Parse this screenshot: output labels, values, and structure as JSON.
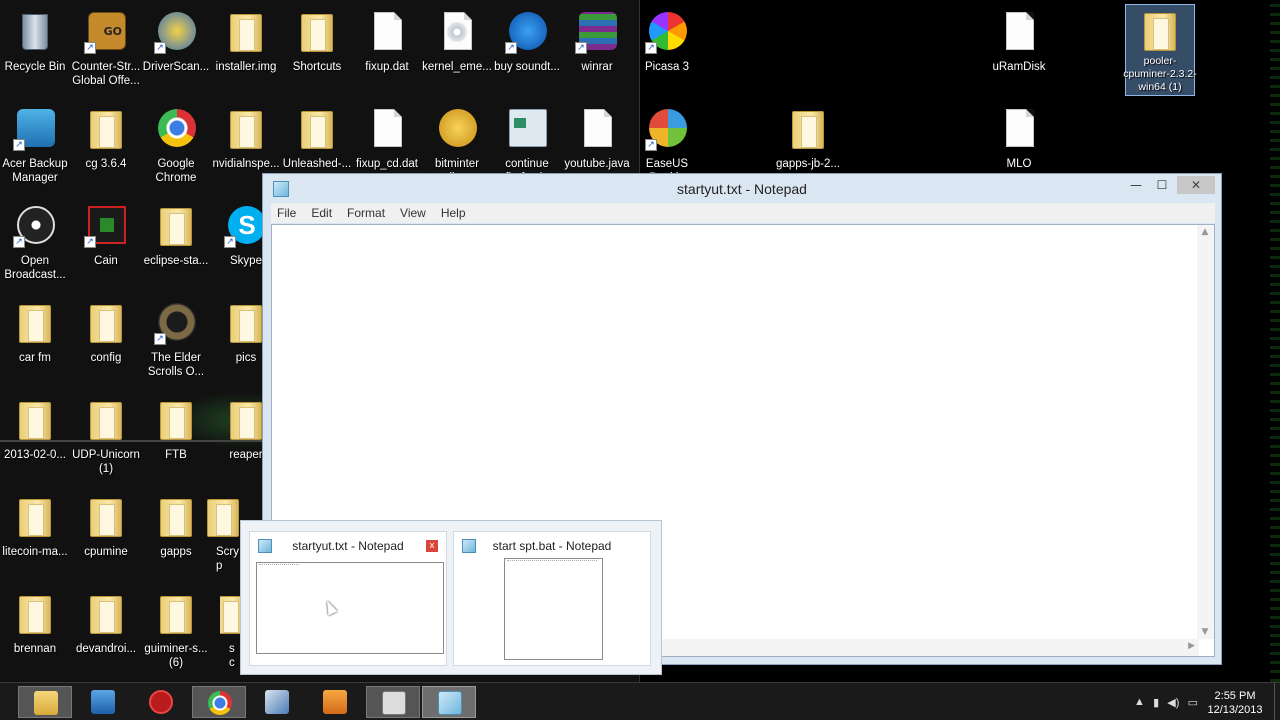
{
  "desktop": {
    "icons": [
      {
        "label": "Recycle Bin",
        "kind": "recycle-bin-icon"
      },
      {
        "label": "Counter-Str... Global Offe...",
        "kind": "csgo-icon"
      },
      {
        "label": "DriverScan...",
        "kind": "driverscanner-icon"
      },
      {
        "label": "installer.img",
        "kind": "folder-icon"
      },
      {
        "label": "Shortcuts",
        "kind": "folder-icon"
      },
      {
        "label": "fixup.dat",
        "kind": "file-icon"
      },
      {
        "label": "kernel_eme...",
        "kind": "disc-image-icon"
      },
      {
        "label": "buy soundt...",
        "kind": "shopping-cart-icon"
      },
      {
        "label": "winrar",
        "kind": "winrar-icon"
      },
      {
        "label": "Picasa 3",
        "kind": "picasa-icon"
      },
      {
        "label": "uRamDisk",
        "kind": "file-icon"
      },
      {
        "label": "pooler-cpuminer-2.3.2-win64 (1)",
        "kind": "zip-folder-icon"
      },
      {
        "label": "Acer Backup Manager",
        "kind": "acer-backup-icon"
      },
      {
        "label": "cg 3.6.4",
        "kind": "folder-icon"
      },
      {
        "label": "Google Chrome",
        "kind": "chrome-icon"
      },
      {
        "label": "nvidialnspe...",
        "kind": "folder-icon"
      },
      {
        "label": "Unleashed-...",
        "kind": "folder-icon"
      },
      {
        "label": "fixup_cd.dat",
        "kind": "file-icon"
      },
      {
        "label": "bitminter client",
        "kind": "bitminter-icon"
      },
      {
        "label": "continue firefox in",
        "kind": "app-window-icon"
      },
      {
        "label": "youtube.java",
        "kind": "file-icon"
      },
      {
        "label": "EaseUS Partitio",
        "kind": "easeus-icon"
      },
      {
        "label": "gapps-jb-2...",
        "kind": "zip-folder-icon"
      },
      {
        "label": "MLO",
        "kind": "file-icon"
      },
      {
        "label": "Open Broadcast...",
        "kind": "obs-icon"
      },
      {
        "label": "Cain",
        "kind": "cain-icon"
      },
      {
        "label": "eclipse-sta...",
        "kind": "folder-icon"
      },
      {
        "label": "Skype",
        "kind": "skype-icon"
      },
      {
        "label": "car fm",
        "kind": "folder-icon"
      },
      {
        "label": "config",
        "kind": "folder-icon"
      },
      {
        "label": "The Elder Scrolls O...",
        "kind": "elder-scrolls-icon"
      },
      {
        "label": "pics",
        "kind": "folder-icon"
      },
      {
        "label": "2013-02-0...",
        "kind": "folder-icon"
      },
      {
        "label": "UDP-Unicorn (1)",
        "kind": "folder-icon"
      },
      {
        "label": "FTB",
        "kind": "folder-icon"
      },
      {
        "label": "reaper",
        "kind": "folder-icon"
      },
      {
        "label": "litecoin-ma...",
        "kind": "folder-icon"
      },
      {
        "label": "cpumine",
        "kind": "folder-icon"
      },
      {
        "label": "gapps",
        "kind": "folder-icon"
      },
      {
        "label": "Scryp",
        "kind": "folder-icon"
      },
      {
        "label": "brennan",
        "kind": "folder-icon"
      },
      {
        "label": "devandroi...",
        "kind": "folder-icon"
      },
      {
        "label": "guiminer-s... (6)",
        "kind": "folder-icon"
      },
      {
        "label": "sc",
        "kind": "folder-icon"
      }
    ]
  },
  "notepad": {
    "title": "startyut.txt - Notepad",
    "menu": [
      "File",
      "Edit",
      "Format",
      "View",
      "Help"
    ],
    "buttons": {
      "min": "—",
      "max": "☐",
      "close": "✕"
    }
  },
  "thumbnails": [
    {
      "title": "startyut.txt - Notepad",
      "close": "x"
    },
    {
      "title": "start spt.bat - Notepad"
    }
  ],
  "taskbar": {
    "apps": [
      "file-explorer-icon",
      "control-panel-icon",
      "power-app-icon",
      "chrome-icon",
      "network-tool-icon",
      "media-player-icon",
      "recorder-icon",
      "notepad-icon"
    ],
    "tray_icons": [
      "▲",
      "▮",
      "◀)",
      "▭"
    ],
    "time": "2:55 PM",
    "date": "12/13/2013"
  },
  "colors": {
    "taskbar": "#1a1a1a",
    "window_frame": "#dbe6f3",
    "thumbnail_close": "#d9453b"
  }
}
